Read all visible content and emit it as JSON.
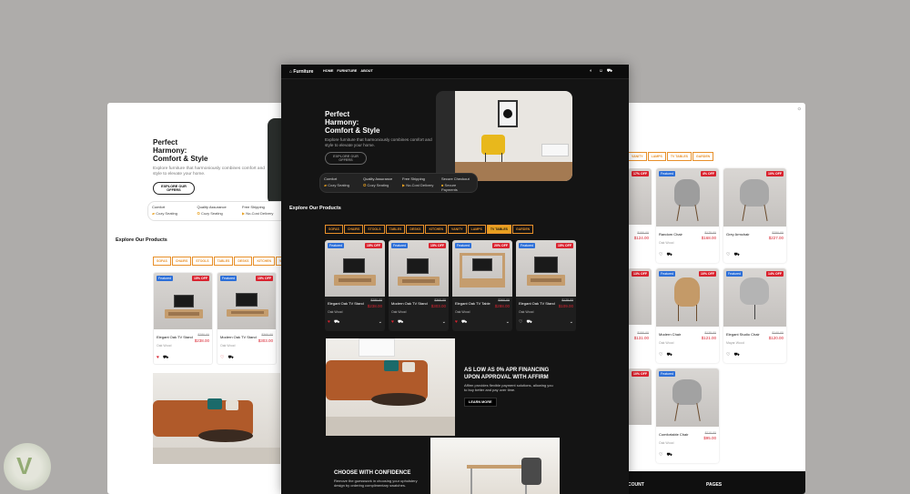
{
  "brand": {
    "name": "Furniture"
  },
  "nav": [
    "HOME",
    "FURNITURE",
    "ABOUT"
  ],
  "hero": {
    "title_lines": [
      "Perfect",
      "Harmony:",
      "Comfort & Style"
    ],
    "subtitle": "Explore furniture that harmoniously combines comfort and style to elevate your home.",
    "cta": "EXPLORE OUR OFFERS"
  },
  "features": [
    {
      "title": "Comfort",
      "sub": "Cozy Seating",
      "icon": "sofa-icon"
    },
    {
      "title": "Quality Assurance",
      "sub": "Cozy Seating",
      "icon": "badge-icon"
    },
    {
      "title": "Free Shipping",
      "sub": "No-Cost Delivery",
      "icon": "truck-icon"
    },
    {
      "title": "Secure Checkout",
      "sub": "Secure Payments",
      "icon": "lock-icon"
    }
  ],
  "products_title": "Explore Our Products",
  "tabs": [
    "SOFAS",
    "CHAIRS",
    "STOOLS",
    "TABLES",
    "DESKS",
    "KITCHEN",
    "VANITY",
    "LAMPS",
    "TV TABLES",
    "GARDEN"
  ],
  "active_tab": "TV TABLES",
  "tv_products": [
    {
      "name": "Elegant Oak TV Stand",
      "badge": "Featured",
      "off": "15% OFF",
      "old": "$280.00",
      "price": "$238.00",
      "brand": "Oak Wood"
    },
    {
      "name": "Modern Oak TV Stand",
      "badge": "Featured",
      "off": "15% OFF",
      "old": "$360.00",
      "price": "$303.00",
      "brand": "Oak Wood"
    },
    {
      "name": "Elegant Oak TV Table",
      "badge": "Featured",
      "off": "20% OFF",
      "old": "$360.00",
      "price": "$288.00",
      "brand": "Oak Wood"
    },
    {
      "name": "Elegant Oak TV Stand",
      "badge": "Featured",
      "off": "15% OFF",
      "old": "$128.00",
      "price": "$109.00",
      "brand": "Oak Wood"
    }
  ],
  "left_products": [
    {
      "name": "Elegant Oak TV Stand",
      "badge": "Featured",
      "off": "15% OFF",
      "old": "$280.00",
      "price": "$238.00",
      "brand": "Oak Wood"
    },
    {
      "name": "Modern Oak TV Stand",
      "badge": "Featured",
      "off": "15% OFF",
      "old": "$360.00",
      "price": "$303.00",
      "brand": "Oak Wood"
    }
  ],
  "right_tabs": [
    "KITCHEN",
    "VANITY",
    "LAMPS",
    "TV TABLES",
    "GARDEN"
  ],
  "chairs": [
    {
      "name": "Random Chair",
      "badge": "Featured",
      "off": "4% OFF",
      "old": "$175.00",
      "price": "$168.00",
      "brand": "Oak Wood"
    },
    {
      "name": "Grey Armchair",
      "badge": "",
      "off": "10% OFF",
      "old": "$250.00",
      "price": "$227.00",
      "brand": "Oak Wood"
    },
    {
      "name": "Modern Chair",
      "badge": "Featured",
      "off": "10% OFF",
      "old": "$135.00",
      "price": "$121.00",
      "brand": "Oak Wood"
    },
    {
      "name": "Elegant Studio Chair",
      "badge": "Featured",
      "off": "14% OFF",
      "old": "$140.00",
      "price": "$120.00",
      "brand": "Mayar Wood"
    },
    {
      "name": "Comfortable Chair",
      "badge": "Featured",
      "off": "",
      "old": "$110.00",
      "price": "$95.00",
      "brand": "Oak Wood"
    }
  ],
  "right_col_prices": [
    {
      "off": "17% OFF",
      "old": "$150.00",
      "price": "$124.00"
    },
    {
      "off": "13% OFF",
      "old": "$150.00",
      "price": "$131.00"
    },
    {
      "off": "10% OFF",
      "old": "",
      "price": ""
    }
  ],
  "promo1": {
    "title": "AS LOW AS 0% APR FINANCING UPON APPROVAL WITH AFFIRM",
    "text": "Affirm provides flexible payment solutions, allowing you to buy better and pay over time.",
    "cta": "LEARN MORE"
  },
  "promo2": {
    "title": "CHOOSE WITH CONFIDENCE",
    "text": "Remove the guesswork in choosing your upholstery design by ordering complimentary swatches."
  },
  "footer": {
    "col1": "COUNT",
    "col2": "PAGES"
  },
  "colors": {
    "accent": "#e8a020",
    "sale": "#d9232f",
    "featured": "#2d6fd8",
    "dark": "#141414"
  }
}
